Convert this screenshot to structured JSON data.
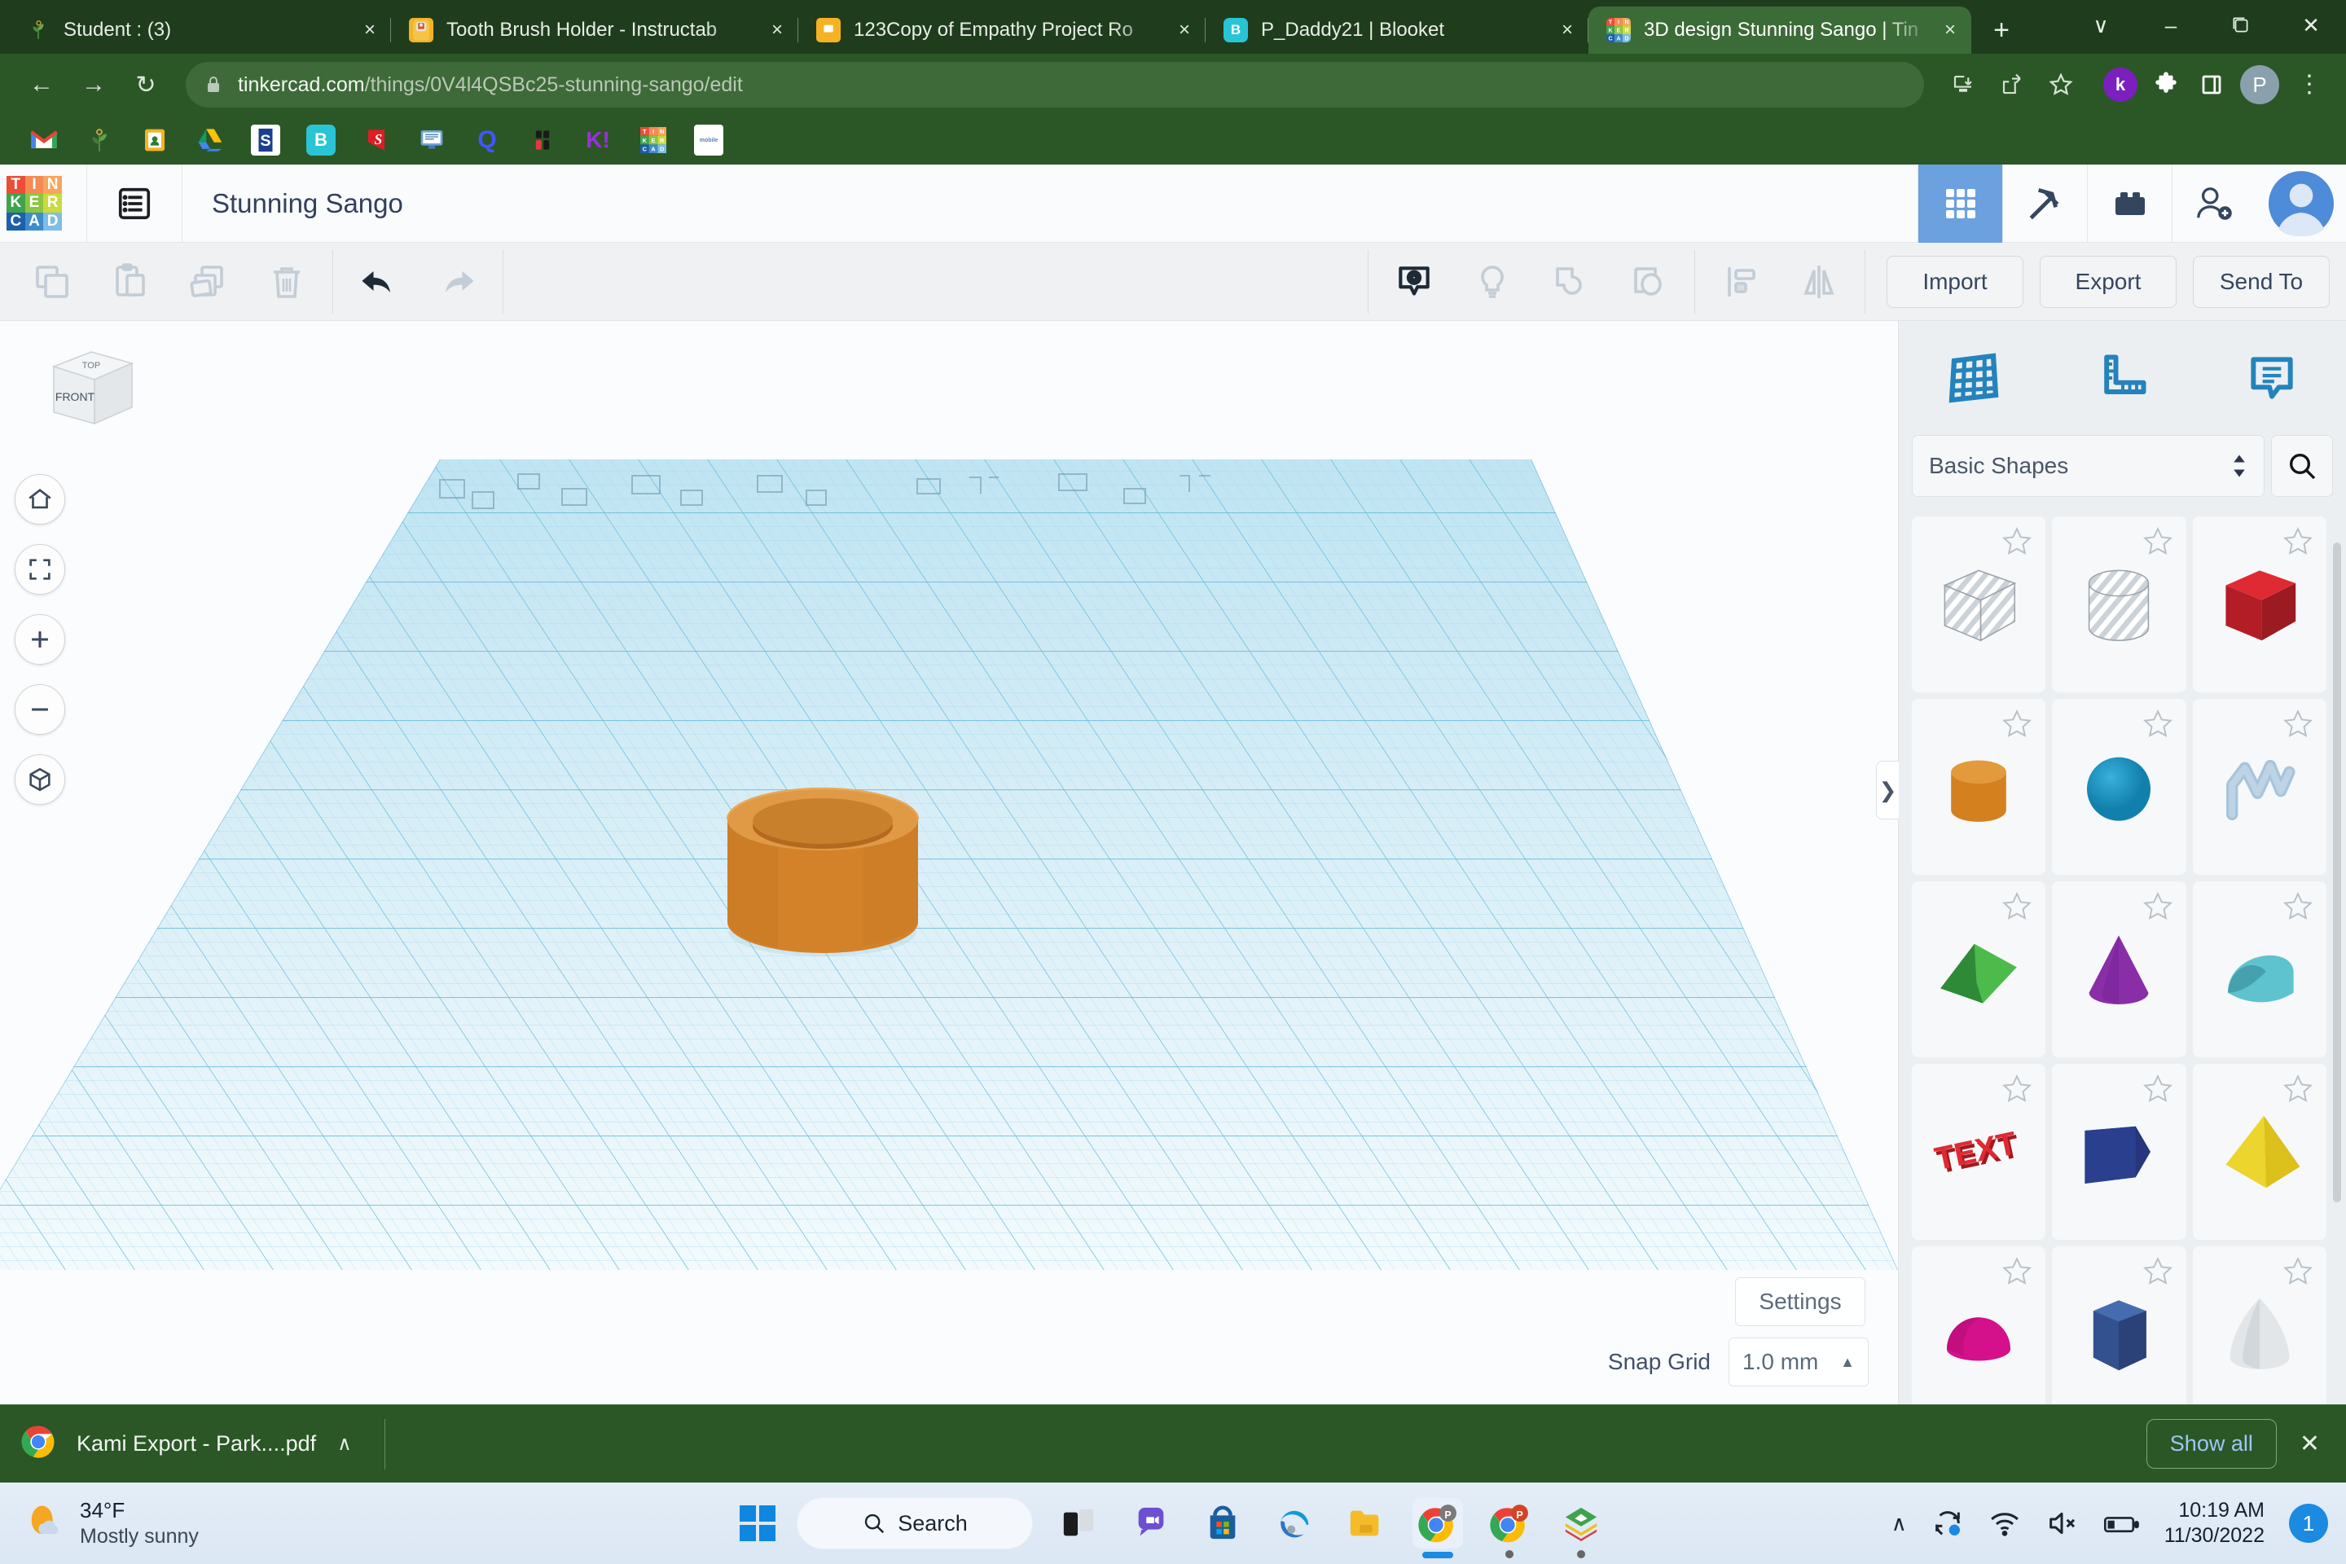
{
  "browser": {
    "tabs": [
      {
        "title": "Student : (3)",
        "favicon": "plant-icon",
        "active": false
      },
      {
        "title": "Tooth Brush Holder - Instructab",
        "favicon": "instructables-icon",
        "active": false
      },
      {
        "title": "123Copy of Empathy Project Ro",
        "favicon": "slides-icon",
        "active": false
      },
      {
        "title": "P_Daddy21 | Blooket",
        "favicon": "blooket-icon",
        "active": false
      },
      {
        "title": "3D design Stunning Sango | Tin",
        "favicon": "tinkercad-icon",
        "active": true
      }
    ],
    "tab_close_label": "×",
    "new_tab_label": "+",
    "window_controls": {
      "minimize": "–",
      "maximize": "❐",
      "close": "✕",
      "tab_search": "∨"
    },
    "nav": {
      "back": "←",
      "forward": "→",
      "reload": "↻"
    },
    "url": {
      "domain": "tinkercad.com",
      "path": "/things/0V4l4QSBc25-stunning-sango/edit",
      "lock": "lock-icon"
    },
    "omni_actions": [
      "install-icon",
      "share-icon",
      "bookmark-star-icon"
    ],
    "extensions": [
      {
        "name": "kami-extension",
        "label": "k"
      },
      {
        "name": "extensions-puzzle-icon",
        "label": ""
      },
      {
        "name": "side-panel-icon",
        "label": ""
      },
      {
        "name": "profile-avatar",
        "label": "P"
      }
    ],
    "menu_label": "⋮",
    "bookmarks": [
      {
        "name": "gmail-bookmark",
        "label": "M"
      },
      {
        "name": "plant-bookmark",
        "label": ""
      },
      {
        "name": "classroom-bookmark",
        "label": ""
      },
      {
        "name": "drive-bookmark",
        "label": ""
      },
      {
        "name": "schoology-bookmark",
        "label": "S"
      },
      {
        "name": "blooket-bookmark",
        "label": "B"
      },
      {
        "name": "scholastic-bookmark",
        "label": "S"
      },
      {
        "name": "desktop-bookmark",
        "label": ""
      },
      {
        "name": "quizlet-bookmark",
        "label": "Q"
      },
      {
        "name": "blooket2-bookmark",
        "label": ""
      },
      {
        "name": "kahoot-bookmark",
        "label": "K!"
      },
      {
        "name": "tinkercad-bookmark",
        "label": ""
      },
      {
        "name": "mobile-bookmark",
        "label": ""
      }
    ]
  },
  "tinkercad": {
    "logo_letters": [
      "T",
      "I",
      "N",
      "K",
      "E",
      "R",
      "C",
      "A",
      "D"
    ],
    "title": "Stunning Sango",
    "header_buttons": [
      {
        "name": "designs-grid-button",
        "icon": "grid-icon",
        "active": true
      },
      {
        "name": "codeblocks-button",
        "icon": "pickaxe-icon",
        "active": false
      },
      {
        "name": "blocks-button",
        "icon": "lego-brick-icon",
        "active": false
      },
      {
        "name": "invite-button",
        "icon": "person-add-icon",
        "active": false
      }
    ],
    "toolbar": {
      "left": [
        {
          "name": "copy-button",
          "icon": "copy-icon"
        },
        {
          "name": "paste-button",
          "icon": "paste-icon"
        },
        {
          "name": "duplicate-button",
          "icon": "duplicate-icon"
        },
        {
          "name": "delete-button",
          "icon": "trash-icon"
        }
      ],
      "history": [
        {
          "name": "undo-button",
          "icon": "undo-arrow-icon"
        },
        {
          "name": "redo-button",
          "icon": "redo-arrow-icon"
        }
      ],
      "middle": [
        {
          "name": "show-hide-button",
          "icon": "eye-tag-icon"
        },
        {
          "name": "light-button",
          "icon": "lightbulb-icon"
        },
        {
          "name": "group-button",
          "icon": "group-shapes-icon"
        },
        {
          "name": "ungroup-button",
          "icon": "ungroup-shapes-icon"
        },
        {
          "name": "align-button",
          "icon": "align-icon"
        },
        {
          "name": "mirror-button",
          "icon": "mirror-icon"
        }
      ],
      "import_label": "Import",
      "export_label": "Export",
      "send_to_label": "Send To"
    },
    "viewcube": {
      "top_label": "TOP",
      "front_label": "FRONT"
    },
    "nav_rail": [
      {
        "name": "home-view-button",
        "icon": "home-icon"
      },
      {
        "name": "fit-to-view-button",
        "icon": "fit-view-icon"
      },
      {
        "name": "zoom-in-button",
        "icon": "plus-icon"
      },
      {
        "name": "zoom-out-button",
        "icon": "minus-icon"
      },
      {
        "name": "ortho-perspective-button",
        "icon": "cube-view-icon"
      }
    ],
    "canvas": {
      "settings_label": "Settings",
      "snap_grid_label": "Snap Grid",
      "snap_grid_value": "1.0 mm",
      "snap_caret": "▲",
      "object": {
        "name": "hollow-cylinder",
        "color": "#d4822a",
        "top_color": "#b5691f"
      }
    },
    "panel": {
      "tabs": [
        {
          "name": "panel-tab-workplane",
          "icon": "workplane-grid-icon"
        },
        {
          "name": "panel-tab-ruler",
          "icon": "ruler-icon"
        },
        {
          "name": "panel-tab-notes",
          "icon": "note-callout-icon"
        }
      ],
      "category": "Basic Shapes",
      "search_icon": "search-icon",
      "collapse_label": "❯",
      "shapes": [
        {
          "name": "box-hole",
          "type": "cube-striped",
          "color": "#c2c8ce"
        },
        {
          "name": "cylinder-hole",
          "type": "cylinder-striped",
          "color": "#c2c8ce"
        },
        {
          "name": "box",
          "type": "cube",
          "color": "#c9232d"
        },
        {
          "name": "cylinder",
          "type": "cylinder",
          "color": "#df8422"
        },
        {
          "name": "sphere",
          "type": "sphere",
          "color": "#1592c4"
        },
        {
          "name": "scribble",
          "type": "scribble",
          "color": "#a8c4da"
        },
        {
          "name": "roof",
          "type": "wedge",
          "color": "#3c9e3c"
        },
        {
          "name": "cone",
          "type": "cone",
          "color": "#7e2f9c"
        },
        {
          "name": "round-roof",
          "type": "round-roof",
          "color": "#5fc0cc"
        },
        {
          "name": "text",
          "type": "text",
          "color": "#c9232d",
          "label": "TEXT"
        },
        {
          "name": "wedge",
          "type": "polygon-wedge",
          "color": "#223a7c"
        },
        {
          "name": "pyramid",
          "type": "pyramid",
          "color": "#e8cd22"
        },
        {
          "name": "half-sphere",
          "type": "half-sphere",
          "color": "#d4108a"
        },
        {
          "name": "polygon",
          "type": "hex-prism",
          "color": "#33508f"
        },
        {
          "name": "paraboloid",
          "type": "paraboloid",
          "color": "#c9ced3"
        }
      ]
    }
  },
  "download_shelf": {
    "file_name": "Kami Export - Park....pdf",
    "file_icon": "chrome-icon",
    "caret": "∧",
    "show_all_label": "Show all",
    "close_label": "✕"
  },
  "taskbar": {
    "weather": {
      "temp": "34°F",
      "desc": "Mostly sunny",
      "icon": "sun-cloud-icon"
    },
    "start_label": "windows-logo",
    "search_placeholder": "Search",
    "apps": [
      {
        "name": "taskview-icon",
        "open": false
      },
      {
        "name": "chat-icon",
        "open": false
      },
      {
        "name": "microsoft-store-icon",
        "open": false
      },
      {
        "name": "edge-icon",
        "open": false
      },
      {
        "name": "file-explorer-icon",
        "open": false
      },
      {
        "name": "chrome-pdf-icon",
        "open": true,
        "focused": true
      },
      {
        "name": "chrome-powerpoint-icon",
        "open": true
      },
      {
        "name": "sketchbook-icon",
        "open": true
      }
    ],
    "tray": {
      "overflow": "∧",
      "sync_icon": "sync-icon",
      "wifi_icon": "wifi-icon",
      "volume_icon": "volume-muted-icon",
      "battery_icon": "battery-icon",
      "time": "10:19 AM",
      "date": "11/30/2022",
      "notification_count": "1"
    }
  }
}
